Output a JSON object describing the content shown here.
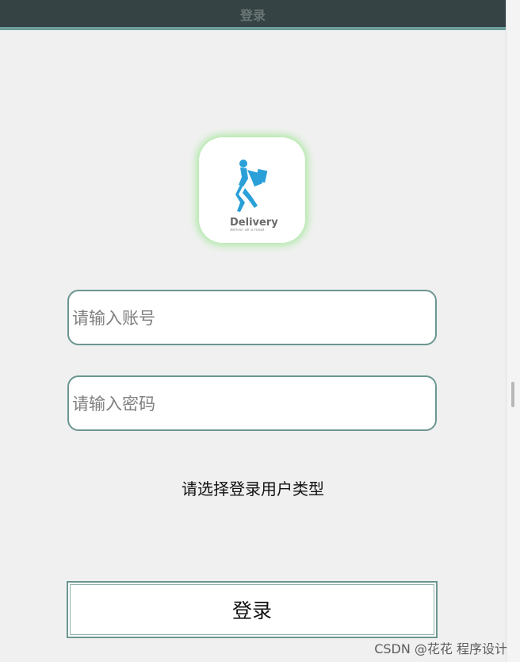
{
  "window": {
    "title": "登录"
  },
  "logo": {
    "brand_text": "Delivery",
    "tagline": "deliver all a meal"
  },
  "form": {
    "account_placeholder": "请输入账号",
    "password_placeholder": "请输入密码",
    "user_type_prompt": "请选择登录用户类型",
    "login_label": "登录"
  },
  "watermark": "CSDN @花花 程序设计",
  "colors": {
    "titlebar": "#354344",
    "accent_border": "#6b9690",
    "logo_glow": "#a9e8a0",
    "logo_figure": "#2a9fd8"
  }
}
